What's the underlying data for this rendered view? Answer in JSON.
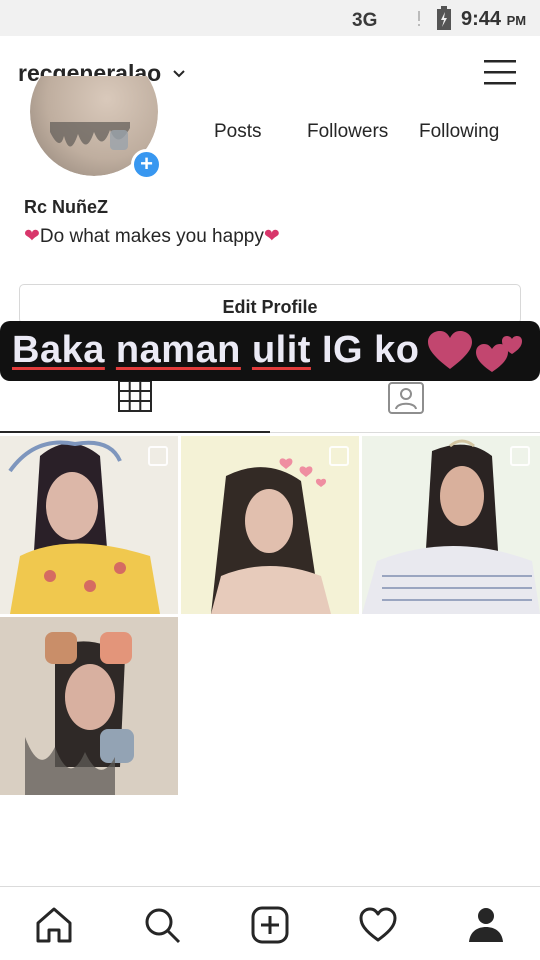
{
  "status_bar": {
    "network": "3G",
    "time": "9:44",
    "ampm": "PM"
  },
  "header": {
    "username": "recgeneralao"
  },
  "profile": {
    "stats": {
      "posts_label": "Posts",
      "followers_label": "Followers",
      "following_label": "Following"
    },
    "display_name": "Rc NuñeZ",
    "bio": {
      "heart_left": "❤",
      "text": "Do what makes you happy",
      "heart_right": "❤"
    },
    "edit_button": "Edit Profile"
  },
  "overlay": {
    "word1": "Baka",
    "word2": "naman",
    "word3": "ulit",
    "word4": "IG ko"
  },
  "tabs": [
    {
      "name": "grid",
      "active": true
    },
    {
      "name": "tagged",
      "active": false
    }
  ],
  "photos": [
    {
      "multi": true
    },
    {
      "multi": true
    },
    {
      "multi": true
    },
    {
      "multi": false
    }
  ],
  "colors": {
    "accent": "#3897f0",
    "heart": "#d8366b",
    "overlay_bg": "#111111",
    "underline": "#e23b3b"
  },
  "icons": [
    "chevron-down-icon",
    "menu-icon",
    "grid-icon",
    "tagged-icon",
    "home-icon",
    "search-icon",
    "add-icon",
    "heart-icon",
    "profile-icon"
  ]
}
